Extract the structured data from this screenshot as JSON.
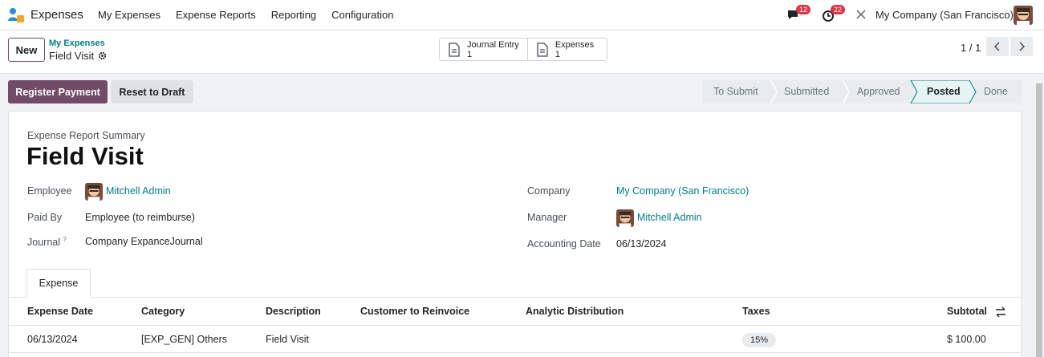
{
  "app": {
    "name": "Expenses",
    "menu": [
      "My Expenses",
      "Expense Reports",
      "Reporting",
      "Configuration"
    ],
    "messages_count": "12",
    "activities_count": "22",
    "company": "My Company (San Francisco)"
  },
  "control_panel": {
    "new_label": "New",
    "breadcrumb_parent": "My Expenses",
    "breadcrumb_current": "Field Visit",
    "smart_buttons": [
      {
        "label": "Journal Entry",
        "count": "1"
      },
      {
        "label": "Expenses",
        "count": "1"
      }
    ],
    "pager": "1 / 1"
  },
  "actions": {
    "register_payment": "Register Payment",
    "reset_to_draft": "Reset to Draft"
  },
  "status": {
    "stages": [
      "To Submit",
      "Submitted",
      "Approved",
      "Posted",
      "Done"
    ],
    "active": "Posted"
  },
  "form": {
    "summary_label": "Expense Report Summary",
    "title": "Field Visit",
    "employee_label": "Employee",
    "employee": "Mitchell Admin",
    "paid_by_label": "Paid By",
    "paid_by": "Employee (to reimburse)",
    "journal_label": "Journal",
    "journal_help": "?",
    "journal": "Company ExpanceJournal",
    "company_label": "Company",
    "company": "My Company (San Francisco)",
    "manager_label": "Manager",
    "manager": "Mitchell Admin",
    "accounting_date_label": "Accounting Date",
    "accounting_date": "06/13/2024"
  },
  "tabs": [
    "Expense"
  ],
  "table": {
    "headers": [
      "Expense Date",
      "Category",
      "Description",
      "Customer to Reinvoice",
      "Analytic Distribution",
      "Taxes",
      "Subtotal"
    ],
    "rows": [
      {
        "date": "06/13/2024",
        "category": "[EXP_GEN] Others",
        "description": "Field Visit",
        "customer": "",
        "analytic": "",
        "taxes": "15%",
        "subtotal": "$ 100.00"
      }
    ]
  },
  "colors": {
    "primary": "#714b67",
    "link": "#017e84",
    "badge": "#dc3545"
  }
}
